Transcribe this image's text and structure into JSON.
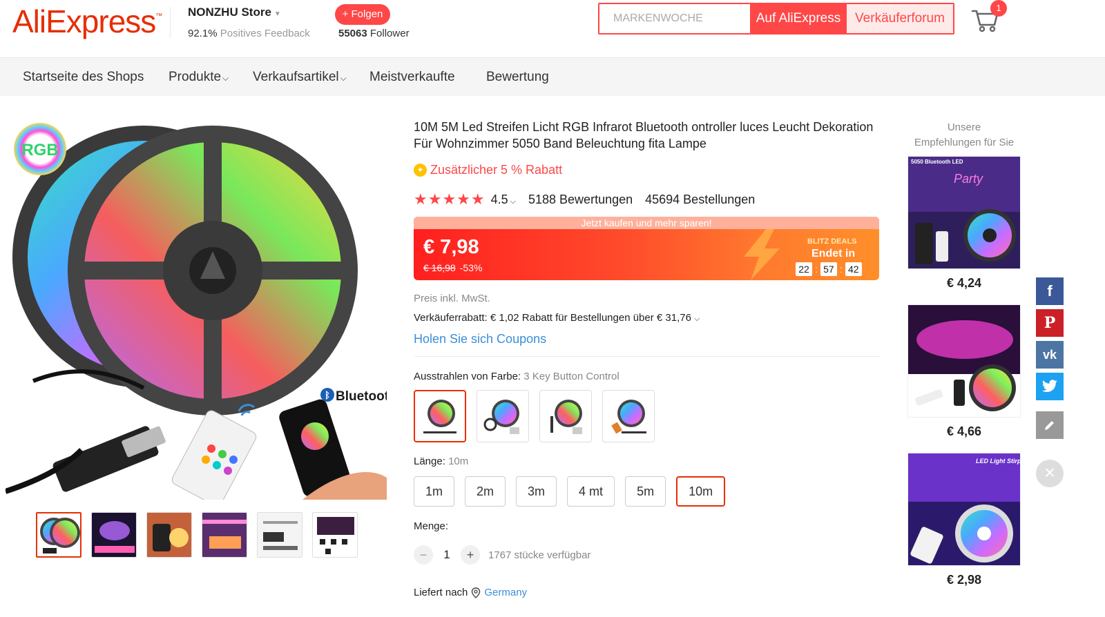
{
  "header": {
    "logo_text": "AliExpress",
    "store_name": "NONZHU Store",
    "feedback_percent": "92.1%",
    "feedback_label": "Positives Feedback",
    "follow_label": "+ Folgen",
    "followers_count": "55063",
    "followers_label": "Follower",
    "search_placeholder": "MARKENWOCHE",
    "search_ali_label": "Auf AliExpress",
    "search_forum_label": "Verkäuferforum",
    "cart_count": "1"
  },
  "nav": {
    "items": [
      "Startseite des Shops",
      "Produkte",
      "Verkaufsartikel",
      "Meistverkaufte",
      "Bewertung"
    ]
  },
  "product": {
    "title": "10M 5M Led Streifen Licht RGB Infrarot Bluetooth ontroller luces Leucht Dekoration Für Wohnzimmer 5050 Band Beleuchtung fita Lampe",
    "extra_discount": "Zusätzlicher 5 % Rabatt",
    "rating": "4.5",
    "reviews": "5188 Bewertungen",
    "orders": "45694 Bestellungen",
    "price_banner": "Jetzt kaufen und mehr sparen!",
    "price": "€ 7,98",
    "old_price": "€ 16,98",
    "discount": "-53%",
    "blitz_label": "BLITZ DEALS",
    "ends_in": "Endet in",
    "timer": [
      "22",
      "57",
      "42"
    ],
    "vat_note": "Preis inkl. MwSt.",
    "seller_discount": "Verkäuferrabatt: € 1,02 Rabatt für Bestellungen über € 31,76",
    "coupons_link": "Holen Sie sich Coupons",
    "color_label": "Ausstrahlen von Farbe:",
    "color_value": "3 Key Button Control",
    "length_label": "Länge:",
    "length_value": "10m",
    "lengths": [
      "1m",
      "2m",
      "3m",
      "4 mt",
      "5m",
      "10m"
    ],
    "quantity_label": "Menge:",
    "quantity": "1",
    "available": "1767 stücke verfügbar",
    "ship_label": "Liefert nach",
    "ship_country": "Germany"
  },
  "main_image": {
    "rgb_badge": "RGB",
    "bluetooth_label": "Bluetooth"
  },
  "recommendations": {
    "title_line1": "Unsere",
    "title_line2": "Empfehlungen für Sie",
    "items": [
      {
        "label": "5050 Bluetooth LED",
        "price": "€ 4,24"
      },
      {
        "label": "",
        "price": "€ 4,66"
      },
      {
        "label": "LED Light Stirp",
        "price": "€ 2,98"
      }
    ]
  },
  "social": {
    "icons": [
      "facebook-icon",
      "pinterest-icon",
      "vk-icon",
      "twitter-icon",
      "edit-icon",
      "close-icon"
    ]
  },
  "colors": {
    "accent": "#ff4747",
    "brand": "#e62e04",
    "link": "#3b8ed8",
    "facebook": "#3b5998",
    "pinterest": "#cb2027",
    "vk": "#4c75a3",
    "twitter": "#1da1f2",
    "edit": "#999999"
  }
}
